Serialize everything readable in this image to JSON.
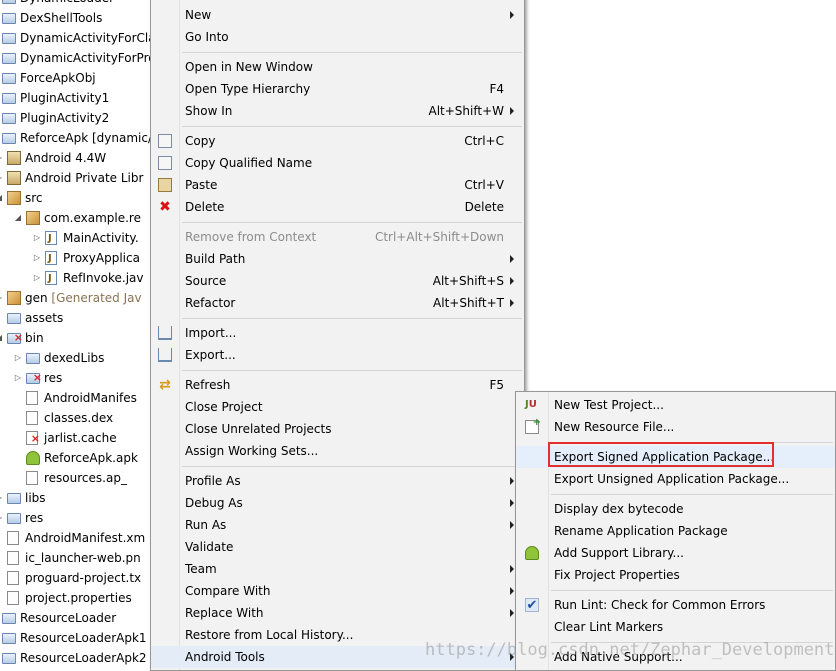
{
  "tree": {
    "items": [
      {
        "label": "DynamicLoader",
        "icon": "project-folder-icon"
      },
      {
        "label": "DexShellTools",
        "icon": "project-folder-icon"
      },
      {
        "label": "DynamicActivityForClas",
        "icon": "project-folder-icon"
      },
      {
        "label": "DynamicActivityForProx",
        "icon": "project-folder-icon"
      },
      {
        "label": "ForceApkObj",
        "icon": "project-folder-icon"
      },
      {
        "label": "PluginActivity1",
        "icon": "project-folder-icon"
      },
      {
        "label": "PluginActivity2",
        "icon": "project-folder-icon"
      },
      {
        "label": "ReforceApk [dynamic/",
        "icon": "project-folder-icon"
      },
      {
        "label": "Android 4.4W",
        "icon": "library-icon"
      },
      {
        "label": "Android Private Libr",
        "icon": "library-icon"
      },
      {
        "label": "src",
        "icon": "source-folder-icon"
      },
      {
        "label": "com.example.re",
        "icon": "package-icon"
      },
      {
        "label": "MainActivity.",
        "icon": "java-file-icon"
      },
      {
        "label": "ProxyApplica",
        "icon": "java-file-icon"
      },
      {
        "label": "RefInvoke.jav",
        "icon": "java-file-icon"
      },
      {
        "label": "gen",
        "suffix": " [Generated Jav",
        "icon": "source-folder-icon"
      },
      {
        "label": "assets",
        "icon": "folder-icon"
      },
      {
        "label": "bin",
        "icon": "folder-icon"
      },
      {
        "label": "dexedLibs",
        "icon": "folder-icon"
      },
      {
        "label": "res",
        "icon": "folder-icon"
      },
      {
        "label": "AndroidManifes",
        "icon": "file-icon"
      },
      {
        "label": "classes.dex",
        "icon": "file-icon"
      },
      {
        "label": "jarlist.cache",
        "icon": "file-icon"
      },
      {
        "label": "ReforceApk.apk",
        "icon": "apk-icon"
      },
      {
        "label": "resources.ap_",
        "icon": "file-icon"
      },
      {
        "label": "libs",
        "icon": "folder-icon"
      },
      {
        "label": "res",
        "icon": "folder-icon"
      },
      {
        "label": "AndroidManifest.xm",
        "icon": "file-icon"
      },
      {
        "label": "ic_launcher-web.pn",
        "icon": "file-icon"
      },
      {
        "label": "proguard-project.tx",
        "icon": "file-icon"
      },
      {
        "label": "project.properties",
        "icon": "file-icon"
      },
      {
        "label": "ResourceLoader",
        "icon": "project-folder-icon"
      },
      {
        "label": "ResourceLoaderApk1",
        "icon": "project-folder-icon"
      },
      {
        "label": "ResourceLoaderApk2",
        "icon": "project-folder-icon"
      }
    ]
  },
  "context_menu": {
    "items": [
      {
        "label": "New",
        "submenu": true
      },
      {
        "label": "Go Into"
      },
      {
        "separator": true
      },
      {
        "label": "Open in New Window"
      },
      {
        "label": "Open Type Hierarchy",
        "shortcut": "F4"
      },
      {
        "label": "Show In",
        "shortcut": "Alt+Shift+W",
        "submenu": true
      },
      {
        "separator": true
      },
      {
        "label": "Copy",
        "shortcut": "Ctrl+C",
        "icon": "copy-icon"
      },
      {
        "label": "Copy Qualified Name",
        "icon": "copy-icon"
      },
      {
        "label": "Paste",
        "shortcut": "Ctrl+V",
        "icon": "paste-icon"
      },
      {
        "label": "Delete",
        "shortcut": "Delete",
        "icon": "delete-icon"
      },
      {
        "separator": true
      },
      {
        "label": "Remove from Context",
        "shortcut": "Ctrl+Alt+Shift+Down",
        "disabled": true
      },
      {
        "label": "Build Path",
        "submenu": true
      },
      {
        "label": "Source",
        "shortcut": "Alt+Shift+S",
        "submenu": true
      },
      {
        "label": "Refactor",
        "shortcut": "Alt+Shift+T",
        "submenu": true
      },
      {
        "separator": true
      },
      {
        "label": "Import...",
        "icon": "import-icon"
      },
      {
        "label": "Export...",
        "icon": "export-icon"
      },
      {
        "separator": true
      },
      {
        "label": "Refresh",
        "shortcut": "F5",
        "icon": "refresh-icon"
      },
      {
        "label": "Close Project"
      },
      {
        "label": "Close Unrelated Projects"
      },
      {
        "label": "Assign Working Sets..."
      },
      {
        "separator": true
      },
      {
        "label": "Profile As",
        "submenu": true
      },
      {
        "label": "Debug As",
        "submenu": true
      },
      {
        "label": "Run As",
        "submenu": true
      },
      {
        "label": "Validate"
      },
      {
        "label": "Team",
        "submenu": true
      },
      {
        "label": "Compare With",
        "submenu": true
      },
      {
        "label": "Replace With",
        "submenu": true
      },
      {
        "label": "Restore from Local History..."
      },
      {
        "label": "Android Tools",
        "submenu": true,
        "active": true
      }
    ]
  },
  "android_tools_menu": {
    "items": [
      {
        "label": "New Test Project...",
        "icon": "junit-icon"
      },
      {
        "label": "New Resource File...",
        "icon": "new-resource-icon"
      },
      {
        "separator": true
      },
      {
        "label": "Export Signed Application Package...",
        "highlighted": true
      },
      {
        "label": "Export Unsigned Application Package..."
      },
      {
        "separator": true
      },
      {
        "label": "Display dex bytecode"
      },
      {
        "label": "Rename Application Package"
      },
      {
        "label": "Add Support Library...",
        "icon": "android-icon"
      },
      {
        "label": "Fix Project Properties"
      },
      {
        "separator": true
      },
      {
        "label": "Run Lint: Check for Common Errors",
        "icon": "lint-check-icon"
      },
      {
        "label": "Clear Lint Markers"
      },
      {
        "separator": true
      },
      {
        "label": "Add Native Support..."
      }
    ]
  },
  "watermark": "https://blog.csdn.net/Zephar_Development",
  "colors": {
    "highlight_border": "#e03030",
    "menu_background": "#f2f2f2"
  }
}
